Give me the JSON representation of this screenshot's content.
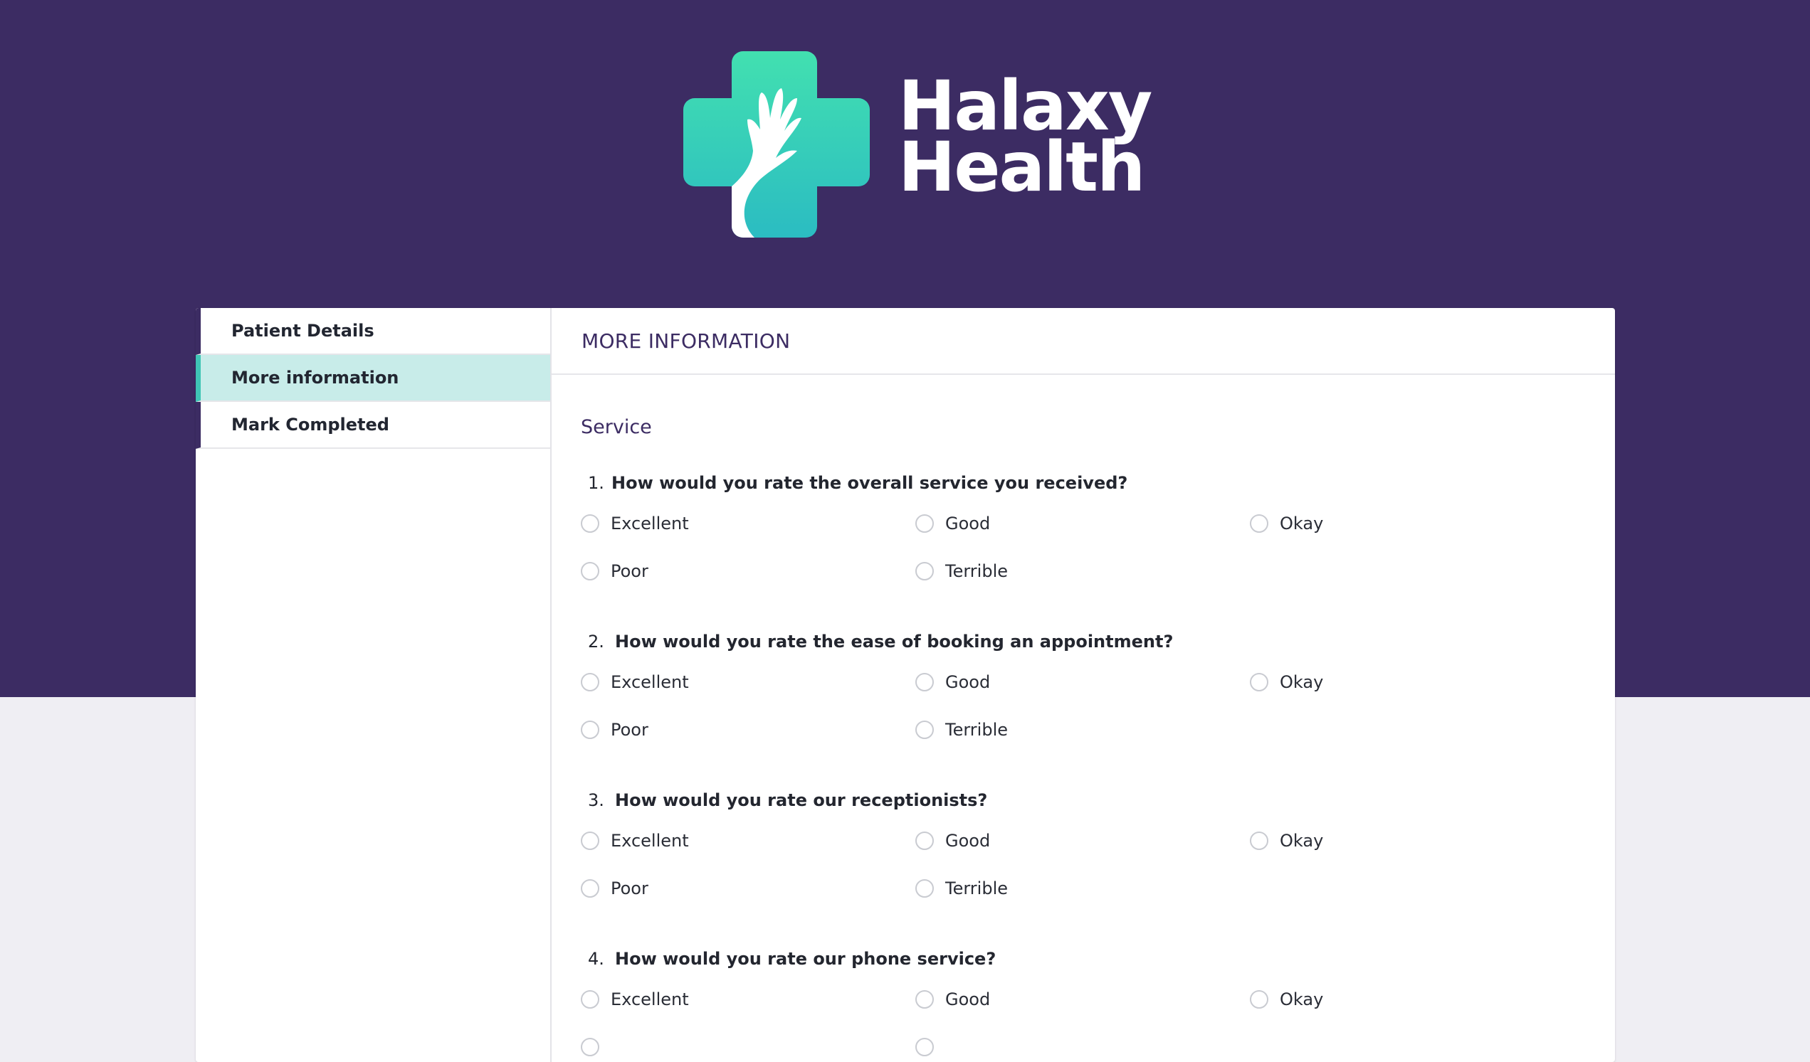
{
  "brand": {
    "line1": "Halaxy",
    "line2": "Health",
    "colors": {
      "hero_bg": "#3c2c63",
      "accent": "#3fc5b5"
    },
    "logo_icon": "medical-cross-hand-icon"
  },
  "sidebar": {
    "items": [
      {
        "label": "Patient Details",
        "active": false
      },
      {
        "label": "More information",
        "active": true
      },
      {
        "label": "Mark Completed",
        "active": false
      }
    ]
  },
  "main": {
    "header": "MORE INFORMATION",
    "section": "Service",
    "questions": [
      {
        "number": "1.",
        "text": "How would you rate the overall service you received?",
        "options": [
          "Excellent",
          "Good",
          "Okay",
          "Poor",
          "Terrible"
        ]
      },
      {
        "number": "2.",
        "text": "How would you rate the ease of booking an appointment?",
        "options": [
          "Excellent",
          "Good",
          "Okay",
          "Poor",
          "Terrible"
        ]
      },
      {
        "number": "3.",
        "text": "How would you rate our receptionists?",
        "options": [
          "Excellent",
          "Good",
          "Okay",
          "Poor",
          "Terrible"
        ]
      },
      {
        "number": "4.",
        "text": "How would you rate our phone service?",
        "options": [
          "Excellent",
          "Good",
          "Okay"
        ]
      }
    ]
  }
}
